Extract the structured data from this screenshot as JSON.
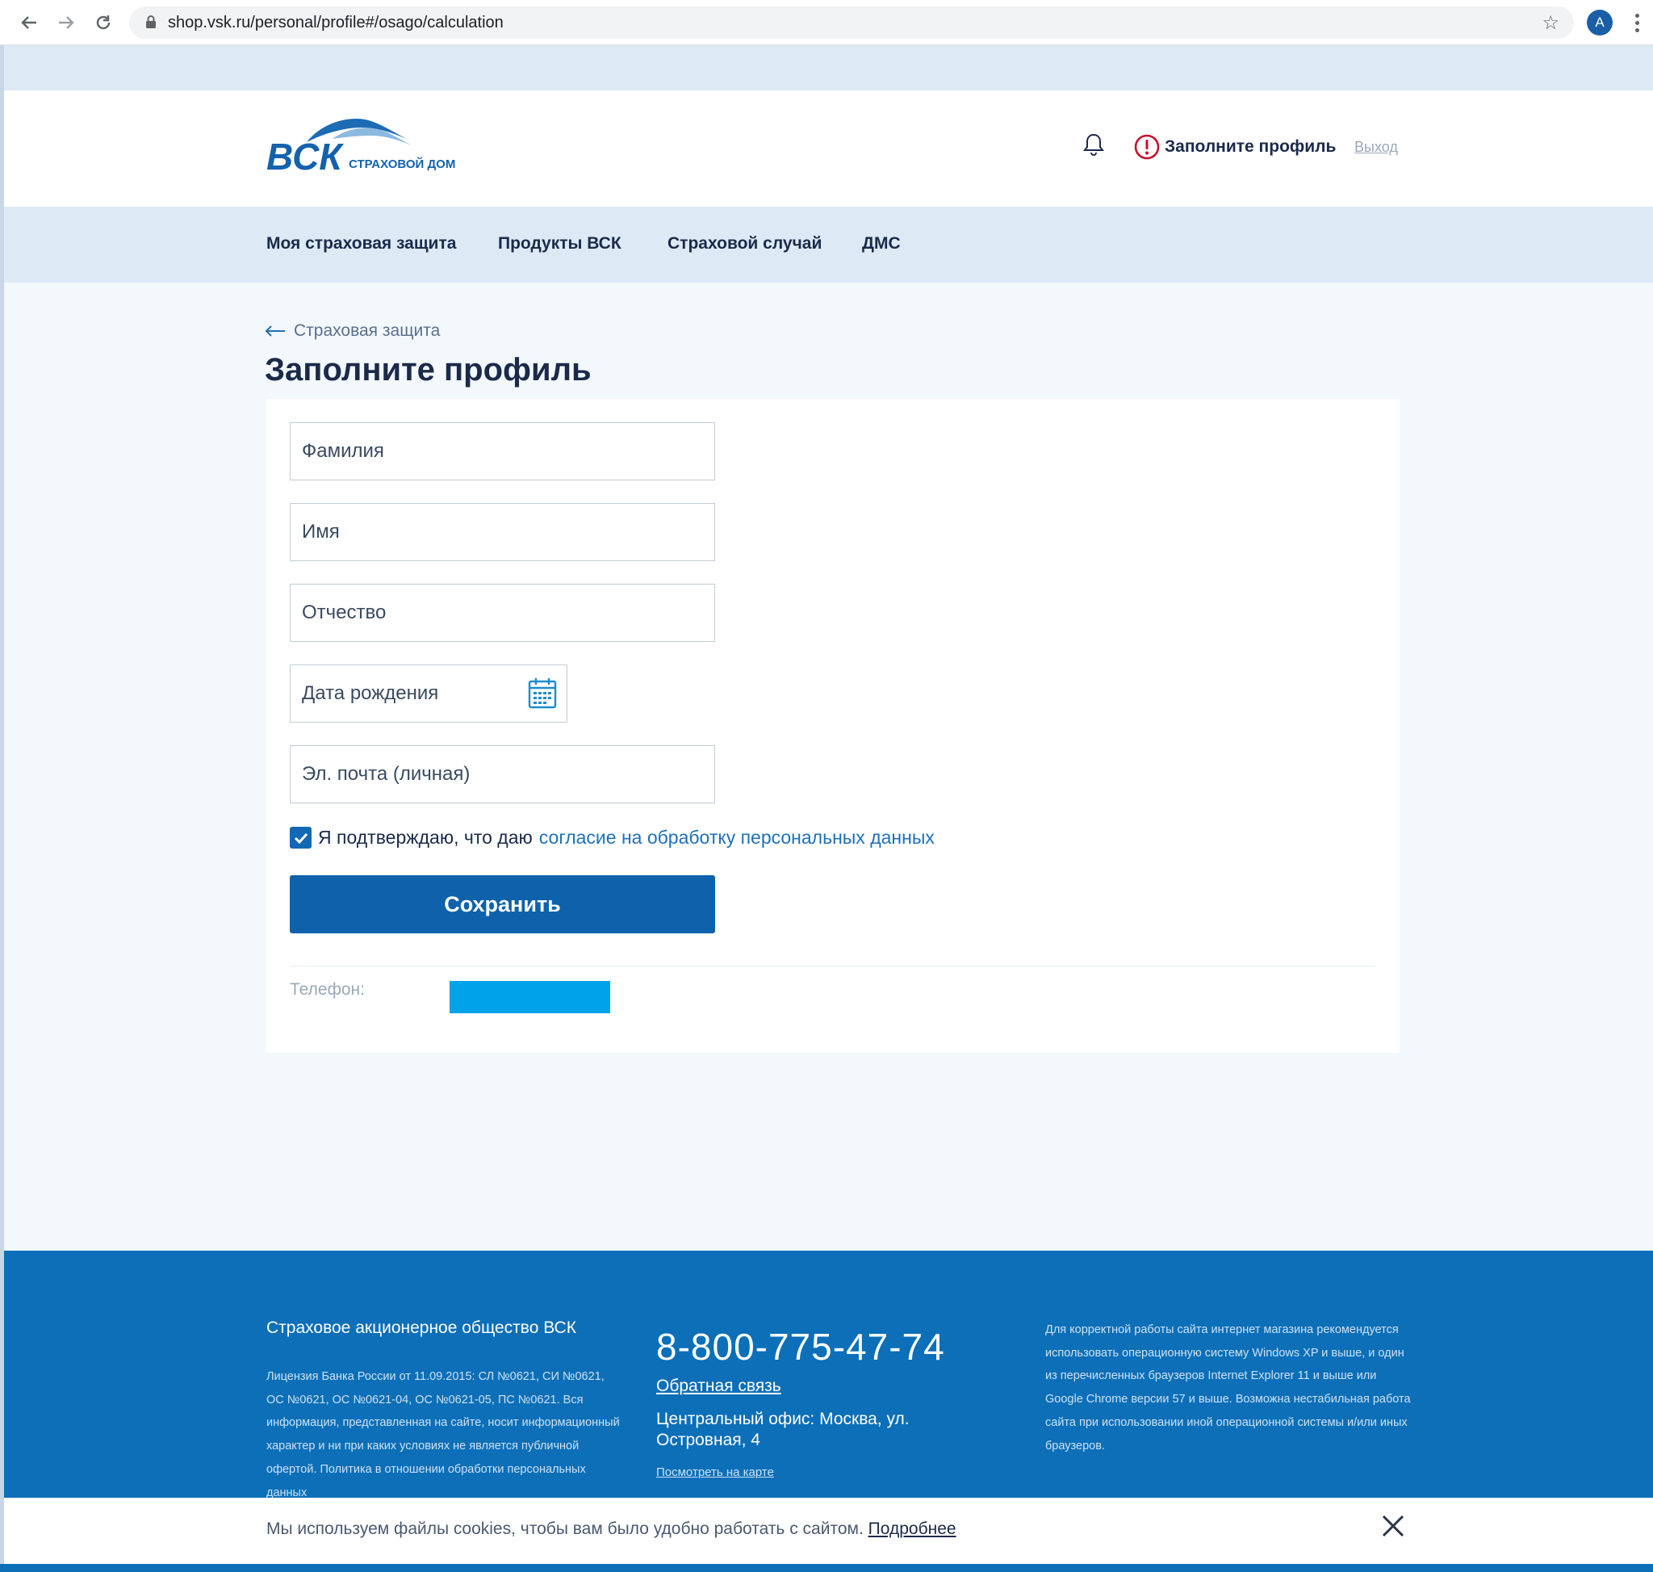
{
  "browser": {
    "url": "shop.vsk.ru/personal/profile#/osago/calculation",
    "avatar_letter": "A"
  },
  "header": {
    "logo_text": "ВСК",
    "logo_subtext": "СТРАХОВОЙ ДОМ",
    "profile_warning": "Заполните профиль",
    "logout": "Выход"
  },
  "nav": {
    "items": [
      "Моя страховая защита",
      "Продукты ВСК",
      "Страховой случай",
      "ДМС"
    ]
  },
  "breadcrumb": {
    "back_label": "Страховая защита"
  },
  "page": {
    "title": "Заполните профиль"
  },
  "form": {
    "last_name_placeholder": "Фамилия",
    "first_name_placeholder": "Имя",
    "patronymic_placeholder": "Отчество",
    "birthdate_placeholder": "Дата рождения",
    "email_placeholder": "Эл. почта (личная)",
    "consent_text": "Я подтверждаю, что даю",
    "consent_link": "согласие на обработку персональных данных",
    "consent_checked": true,
    "save_label": "Сохранить",
    "phone_label": "Телефон:"
  },
  "footer": {
    "company": "Страховое акционерное общество ВСК",
    "license": "Лицензия Банка России от 11.09.2015: СЛ №0621, СИ №0621, ОС №0621, ОС №0621-04, ОС №0621-05, ПС №0621. Вся информация, представленная на сайте, носит информационный характер и ни при каких условиях не является публичной офертой. Политика в отношении обработки персональных данных",
    "phone": "8-800-775-47-74",
    "feedback": "Обратная связь",
    "office": "Центральный офис: Москва, ул. Островная, 4",
    "map_link": "Посмотреть на карте",
    "notice": "Для корректной работы сайта интернет магазина рекомендуется использовать операционную систему Windows XP и выше, и один из перечисленных браузеров Internet Explorer 11 и выше или Google Chrome версии 57 и выше. Возможна нестабильная работа сайта при использовании иной операционной системы и/или иных браузеров."
  },
  "cookie": {
    "text": "Мы используем файлы cookies, чтобы вам было удобно работать с сайтом.",
    "link": "Подробнее"
  },
  "colors": {
    "brand_blue": "#0e62ab",
    "footer_blue": "#0c6fb8",
    "warning_red": "#c8102e",
    "phone_redaction": "#00a3e8"
  }
}
